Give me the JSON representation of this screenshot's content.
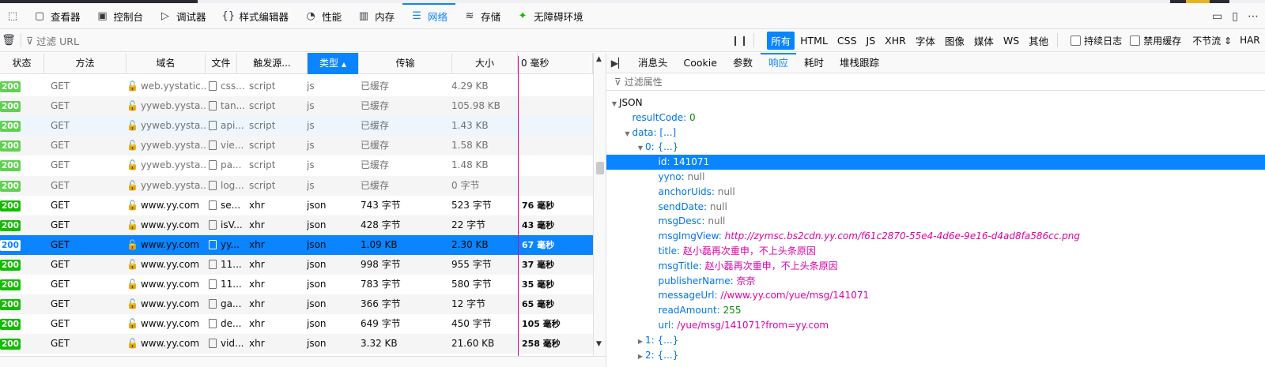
{
  "toolbox": {
    "tabs": [
      {
        "label": "查看器",
        "icon": "inspector-icon"
      },
      {
        "label": "控制台",
        "icon": "console-icon"
      },
      {
        "label": "调试器",
        "icon": "debugger-icon"
      },
      {
        "label": "样式编辑器",
        "icon": "style-editor-icon"
      },
      {
        "label": "性能",
        "icon": "performance-icon"
      },
      {
        "label": "内存",
        "icon": "memory-icon"
      },
      {
        "label": "网络",
        "icon": "network-icon",
        "active": true
      },
      {
        "label": "存储",
        "icon": "storage-icon"
      },
      {
        "label": "无障碍环境",
        "icon": "accessibility-icon"
      }
    ]
  },
  "filterbar": {
    "url_placeholder": "过滤 URL",
    "types": [
      "所有",
      "HTML",
      "CSS",
      "JS",
      "XHR",
      "字体",
      "图像",
      "媒体",
      "WS",
      "其他"
    ],
    "persist_log": "持续日志",
    "disable_cache": "禁用缓存",
    "throttle": "不节流 ⇕",
    "har": "HAR"
  },
  "columns": {
    "status": "状态",
    "method": "方法",
    "domain": "域名",
    "file": "文件",
    "cause": "触发源...",
    "type": "类型",
    "transferred": "传输",
    "size": "大小",
    "waterfall": "0 毫秒"
  },
  "requests": [
    {
      "status": "200",
      "method": "GET",
      "domain": "web.yystatic....",
      "file": "css...",
      "cause": "script",
      "type": "js",
      "transferred": "已缓存",
      "size": "4.29 KB",
      "time": "",
      "cached": true
    },
    {
      "status": "200",
      "method": "GET",
      "domain": "yyweb.yysta...",
      "file": "tan...",
      "cause": "script",
      "type": "js",
      "transferred": "已缓存",
      "size": "105.98 KB",
      "time": "",
      "cached": true
    },
    {
      "status": "200",
      "method": "GET",
      "domain": "yyweb.yysta...",
      "file": "api...",
      "cause": "script",
      "type": "js",
      "transferred": "已缓存",
      "size": "1.43 KB",
      "time": "",
      "cached": true
    },
    {
      "status": "200",
      "method": "GET",
      "domain": "yyweb.yysta...",
      "file": "vie...",
      "cause": "script",
      "type": "js",
      "transferred": "已缓存",
      "size": "1.58 KB",
      "time": "",
      "cached": true
    },
    {
      "status": "200",
      "method": "GET",
      "domain": "yyweb.yysta...",
      "file": "pa...",
      "cause": "script",
      "type": "js",
      "transferred": "已缓存",
      "size": "1.48 KB",
      "time": "",
      "cached": true
    },
    {
      "status": "200",
      "method": "GET",
      "domain": "yyweb.yysta...",
      "file": "log...",
      "cause": "script",
      "type": "js",
      "transferred": "已缓存",
      "size": "0 字节",
      "time": "",
      "cached": true
    },
    {
      "status": "200",
      "method": "GET",
      "domain": "www.yy.com",
      "file": "se...",
      "cause": "xhr",
      "type": "json",
      "transferred": "743 字节",
      "size": "523 字节",
      "time": "76 毫秒",
      "cached": false
    },
    {
      "status": "200",
      "method": "GET",
      "domain": "www.yy.com",
      "file": "isV...",
      "cause": "xhr",
      "type": "json",
      "transferred": "428 字节",
      "size": "22 字节",
      "time": "43 毫秒",
      "cached": false
    },
    {
      "status": "200",
      "method": "GET",
      "domain": "www.yy.com",
      "file": "yy...",
      "cause": "xhr",
      "type": "json",
      "transferred": "1.09 KB",
      "size": "2.30 KB",
      "time": "67 毫秒",
      "cached": false,
      "selected": true
    },
    {
      "status": "200",
      "method": "GET",
      "domain": "www.yy.com",
      "file": "11...",
      "cause": "xhr",
      "type": "json",
      "transferred": "998 字节",
      "size": "955 字节",
      "time": "37 毫秒",
      "cached": false
    },
    {
      "status": "200",
      "method": "GET",
      "domain": "www.yy.com",
      "file": "11...",
      "cause": "xhr",
      "type": "json",
      "transferred": "783 字节",
      "size": "580 字节",
      "time": "35 毫秒",
      "cached": false
    },
    {
      "status": "200",
      "method": "GET",
      "domain": "www.yy.com",
      "file": "ga...",
      "cause": "xhr",
      "type": "json",
      "transferred": "366 字节",
      "size": "12 字节",
      "time": "65 毫秒",
      "cached": false
    },
    {
      "status": "200",
      "method": "GET",
      "domain": "www.yy.com",
      "file": "de...",
      "cause": "xhr",
      "type": "json",
      "transferred": "649 字节",
      "size": "450 字节",
      "time": "105 毫秒",
      "cached": false
    },
    {
      "status": "200",
      "method": "GET",
      "domain": "www.yy.com",
      "file": "vid...",
      "cause": "xhr",
      "type": "json",
      "transferred": "3.32 KB",
      "size": "21.60 KB",
      "time": "258 毫秒",
      "cached": false
    }
  ],
  "detail": {
    "tabs": [
      "消息头",
      "Cookie",
      "参数",
      "响应",
      "耗时",
      "堆栈跟踪"
    ],
    "active_tab": "响应",
    "prop_filter_placeholder": "过滤属性",
    "tree": [
      {
        "depth": 0,
        "twisty": "open",
        "key": "JSON",
        "val": "",
        "vtype": "plain"
      },
      {
        "depth": 1,
        "twisty": "",
        "key": "resultCode:",
        "val": "0",
        "vtype": "num"
      },
      {
        "depth": 1,
        "twisty": "open",
        "key": "data:",
        "val": "[...]",
        "vtype": "obj"
      },
      {
        "depth": 2,
        "twisty": "open",
        "key": "0:",
        "val": "{...}",
        "vtype": "obj"
      },
      {
        "depth": 3,
        "twisty": "",
        "key": "id:",
        "val": "141071",
        "vtype": "num",
        "selected": true
      },
      {
        "depth": 3,
        "twisty": "",
        "key": "yyno:",
        "val": "null",
        "vtype": "null"
      },
      {
        "depth": 3,
        "twisty": "",
        "key": "anchorUids:",
        "val": "null",
        "vtype": "null"
      },
      {
        "depth": 3,
        "twisty": "",
        "key": "sendDate:",
        "val": "null",
        "vtype": "null"
      },
      {
        "depth": 3,
        "twisty": "",
        "key": "msgDesc:",
        "val": "null",
        "vtype": "null"
      },
      {
        "depth": 3,
        "twisty": "",
        "key": "msgImgView:",
        "val": "http://zymsc.bs2cdn.yy.com/f61c2870-55e4-4d6e-9e16-d4ad8fa586cc.png",
        "vtype": "url"
      },
      {
        "depth": 3,
        "twisty": "",
        "key": "title:",
        "val": "赵小磊再次重申，不上头条原因",
        "vtype": "str"
      },
      {
        "depth": 3,
        "twisty": "",
        "key": "msgTitle:",
        "val": "赵小磊再次重申，不上头条原因",
        "vtype": "str"
      },
      {
        "depth": 3,
        "twisty": "",
        "key": "publisherName:",
        "val": "奈奈",
        "vtype": "str"
      },
      {
        "depth": 3,
        "twisty": "",
        "key": "messageUrl:",
        "val": "//www.yy.com/yue/msg/141071",
        "vtype": "str"
      },
      {
        "depth": 3,
        "twisty": "",
        "key": "readAmount:",
        "val": "255",
        "vtype": "num"
      },
      {
        "depth": 3,
        "twisty": "",
        "key": "url:",
        "val": "/yue/msg/141071?from=yy.com",
        "vtype": "str"
      },
      {
        "depth": 2,
        "twisty": "closed",
        "key": "1:",
        "val": "{...}",
        "vtype": "obj"
      },
      {
        "depth": 2,
        "twisty": "closed",
        "key": "2:",
        "val": "{...}",
        "vtype": "obj"
      }
    ]
  }
}
